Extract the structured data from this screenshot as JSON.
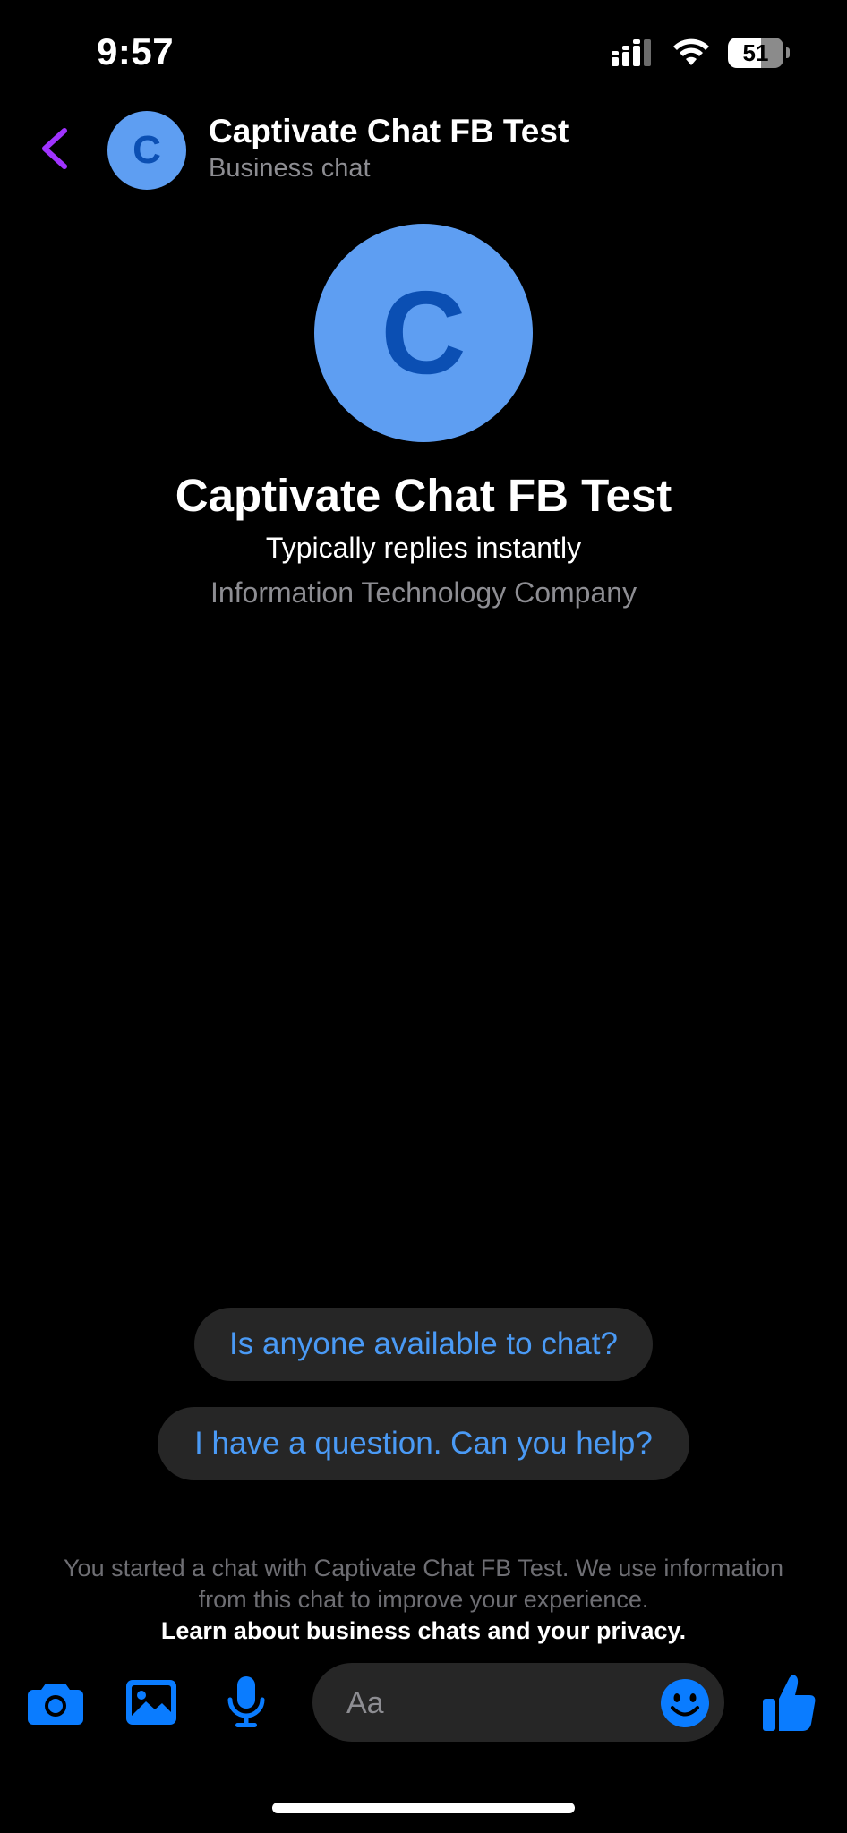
{
  "status_bar": {
    "time": "9:57",
    "battery": "51"
  },
  "header": {
    "avatar_letter": "C",
    "title": "Captivate Chat FB Test",
    "subtitle": "Business chat"
  },
  "profile": {
    "avatar_letter": "C",
    "name": "Captivate Chat FB Test",
    "response_time": "Typically replies instantly",
    "category": "Information Technology Company"
  },
  "quick_replies": [
    "Is anyone available to chat?",
    "I have a question. Can you help?"
  ],
  "disclaimer": {
    "text": "You started a chat with Captivate Chat FB Test. We use information from this chat to improve your experience.",
    "link": "Learn about business chats and your privacy."
  },
  "composer": {
    "placeholder": "Aa"
  },
  "colors": {
    "accent": "#0a7cff",
    "back_arrow": "#a033ff",
    "avatar_bg": "#5e9ef2",
    "avatar_letter": "#0b4fb3",
    "quick_reply_text": "#4a9af5"
  },
  "icons": [
    "back-arrow-icon",
    "camera-icon",
    "gallery-icon",
    "microphone-icon",
    "emoji-icon",
    "thumbs-up-icon",
    "signal-icon",
    "wifi-icon",
    "battery-icon"
  ]
}
